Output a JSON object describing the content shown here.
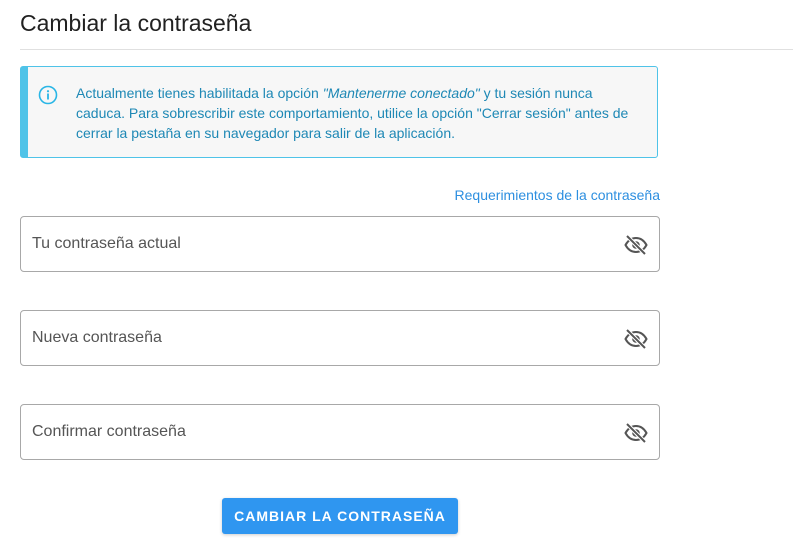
{
  "page": {
    "title": "Cambiar la contraseña"
  },
  "alert": {
    "text_before": "Actualmente tienes habilitada la opción ",
    "text_emphasis": "\"Mantenerme conectado\"",
    "text_after": " y tu sesión nunca caduca. Para sobrescribir este comportamiento, utilice la opción \"Cerrar sesión\" antes de cerrar la pestaña en su navegador para salir de la aplicación.",
    "icon": "info-icon",
    "color": "#1e88b5",
    "border_color": "#4fc3e8"
  },
  "requirements_link": "Requerimientos de la contraseña",
  "fields": {
    "current": {
      "value": "",
      "placeholder": "Tu contraseña actual",
      "icon": "eye-slash-icon"
    },
    "new": {
      "value": "",
      "placeholder": "Nueva contraseña",
      "icon": "eye-slash-icon"
    },
    "confirm": {
      "value": "",
      "placeholder": "Confirmar contraseña",
      "icon": "eye-slash-icon"
    }
  },
  "submit_label": "CAMBIAR LA CONTRASEÑA",
  "colors": {
    "accent": "#2f96f0",
    "link": "#2d8fe0"
  }
}
